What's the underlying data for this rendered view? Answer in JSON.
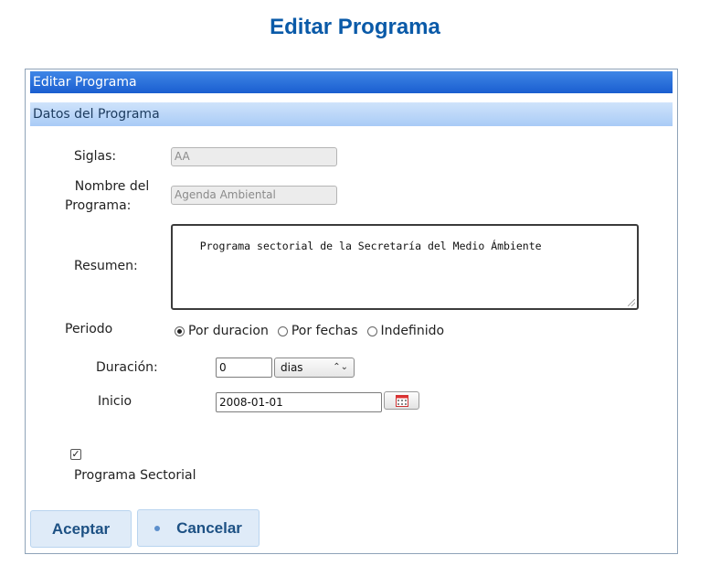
{
  "page": {
    "title": "Editar Programa"
  },
  "panel": {
    "header": "Editar Programa",
    "section": "Datos del Programa"
  },
  "form": {
    "siglas": {
      "label": "Siglas:",
      "value": "AA"
    },
    "nombre": {
      "label_line1": "Nombre del",
      "label_line2": "Programa:",
      "value": "Agenda Ambiental"
    },
    "resumen": {
      "label": "Resumen:",
      "value": "Programa sectorial de la Secretaría del Medio Ámbiente"
    },
    "periodo": {
      "label": "Periodo",
      "options": [
        "Por duracion",
        "Por fechas",
        "Indefinido"
      ],
      "selected": "Por duracion"
    },
    "duracion": {
      "label": "Duración:",
      "value": "0",
      "unit": "dias"
    },
    "inicio": {
      "label": "Inicio",
      "value": "2008-01-01"
    },
    "sectorial": {
      "label": "Programa Sectorial",
      "checked": true,
      "check_glyph": "✓"
    }
  },
  "buttons": {
    "accept": "Aceptar",
    "cancel": "Cancelar"
  },
  "icons": {
    "calendar": "calendar-icon",
    "select_arrows": "⌃⌄"
  }
}
